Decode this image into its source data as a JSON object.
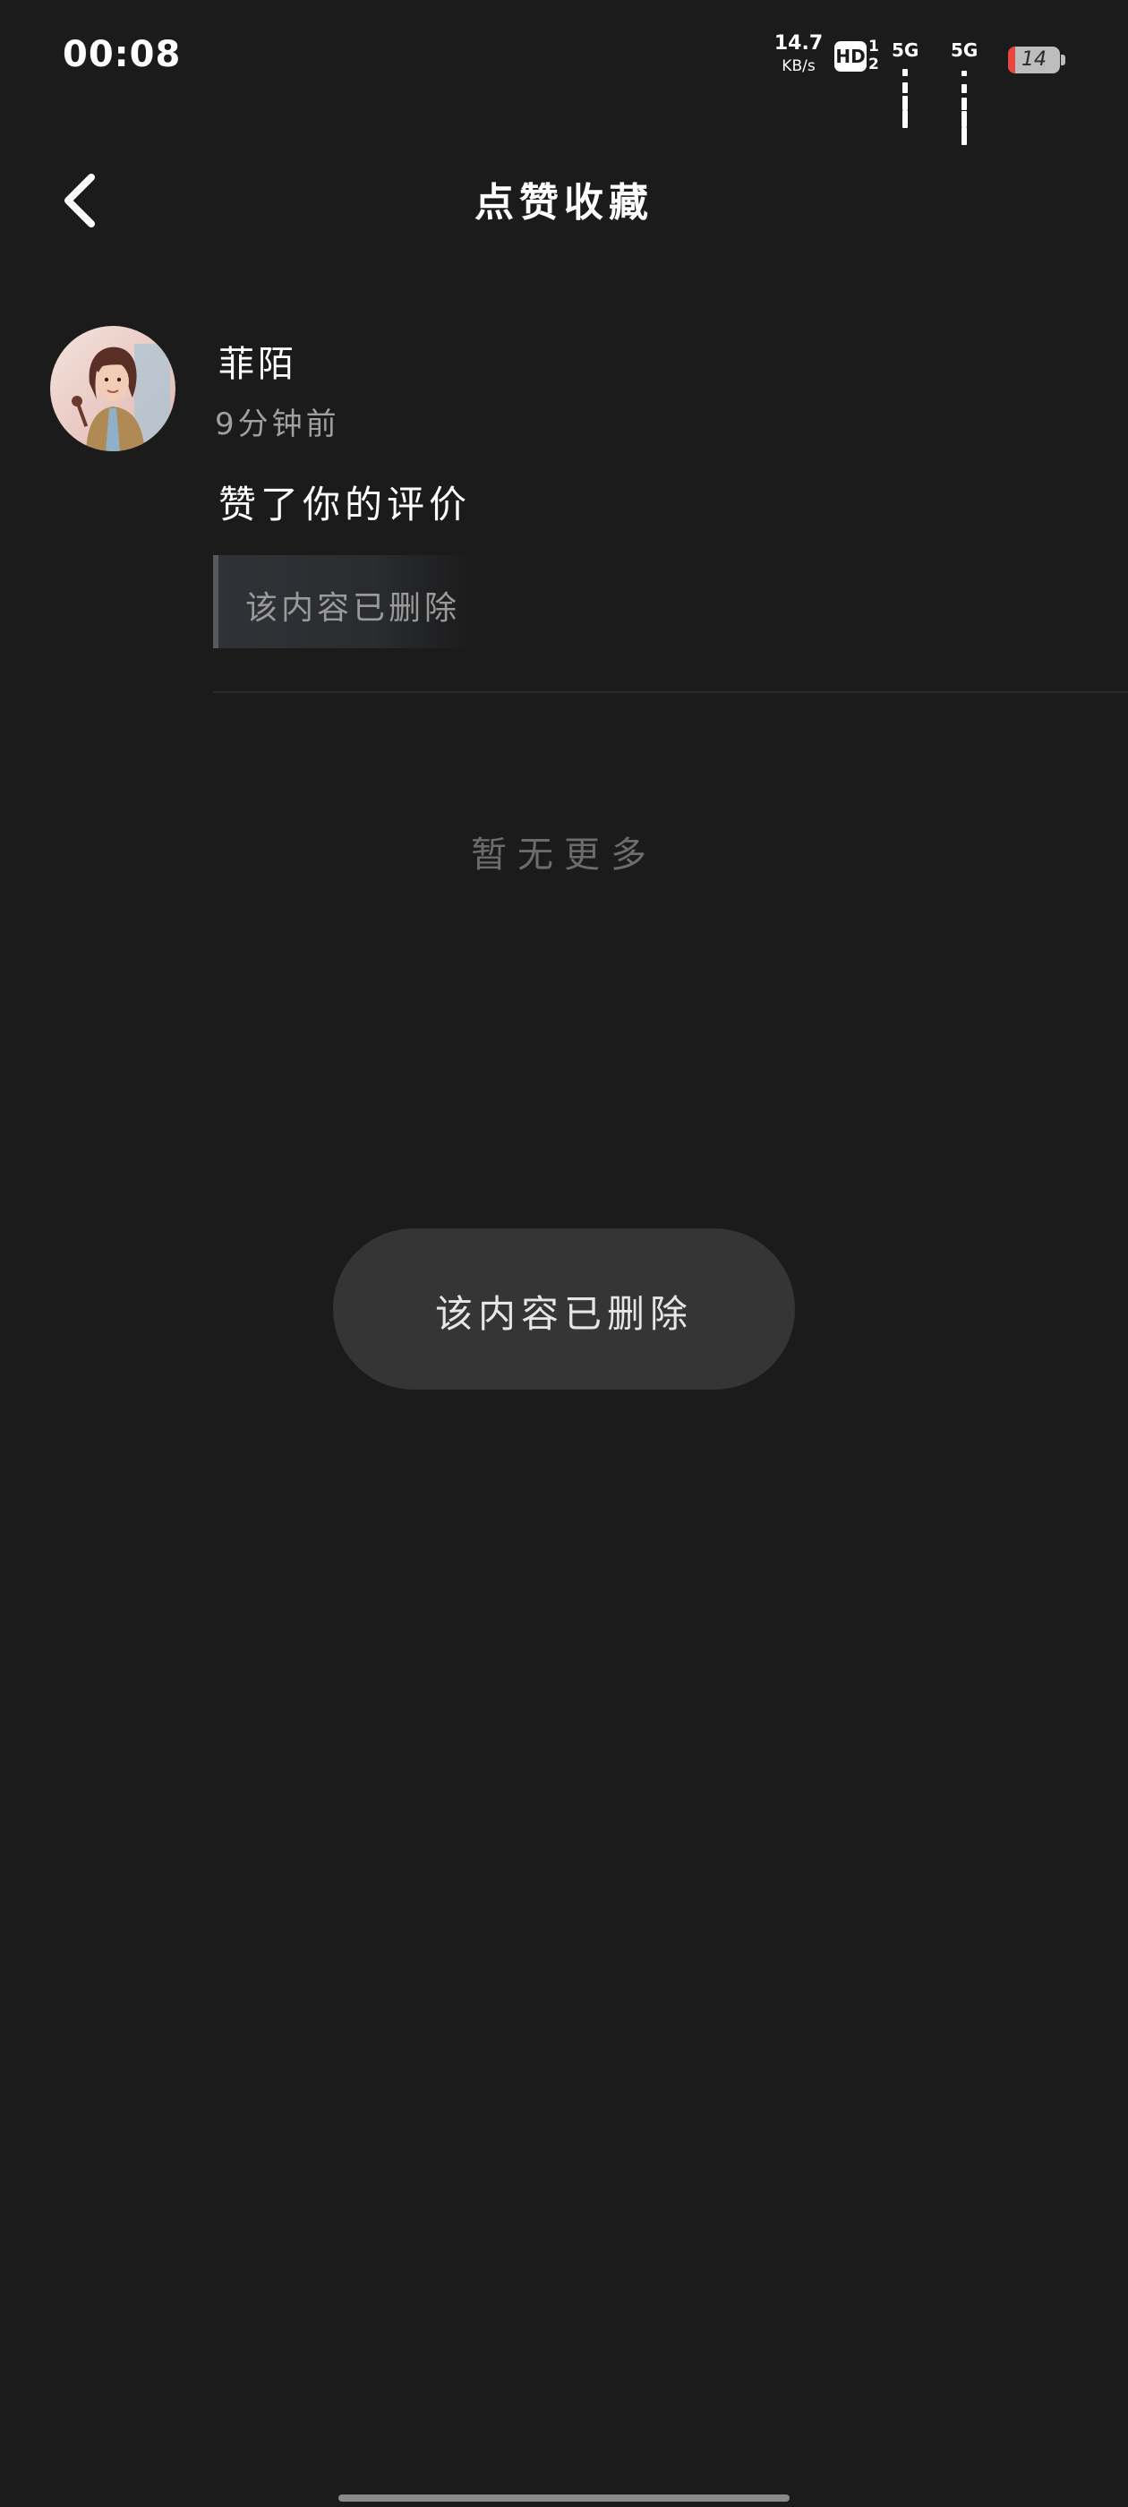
{
  "status_bar": {
    "time": "00:08",
    "net_speed_value": "14.7",
    "net_speed_unit": "KB/s",
    "hd_badge": "HD",
    "hd_sub_top": "1",
    "hd_sub_bottom": "2",
    "sim1_label": "5G",
    "sim2_label": "5G",
    "battery_level": "14",
    "battery_fraction": 0.14,
    "battery_color": "#e8453c"
  },
  "header": {
    "back_icon": "chevron-left-icon",
    "title": "点赞收藏"
  },
  "notifications": [
    {
      "user_name": "菲陌",
      "time_ago": "9分钟前",
      "action": "赞了你的评价",
      "quoted_content": "该内容已删除"
    }
  ],
  "footer": {
    "no_more": "暂无更多"
  },
  "toast": {
    "message": "该内容已删除"
  },
  "colors": {
    "background": "#1b1b1b",
    "primary_text": "#ffffff",
    "secondary_text": "#a0a0a0",
    "muted_text": "#6c6c6c",
    "toast_bg": "#353535"
  }
}
